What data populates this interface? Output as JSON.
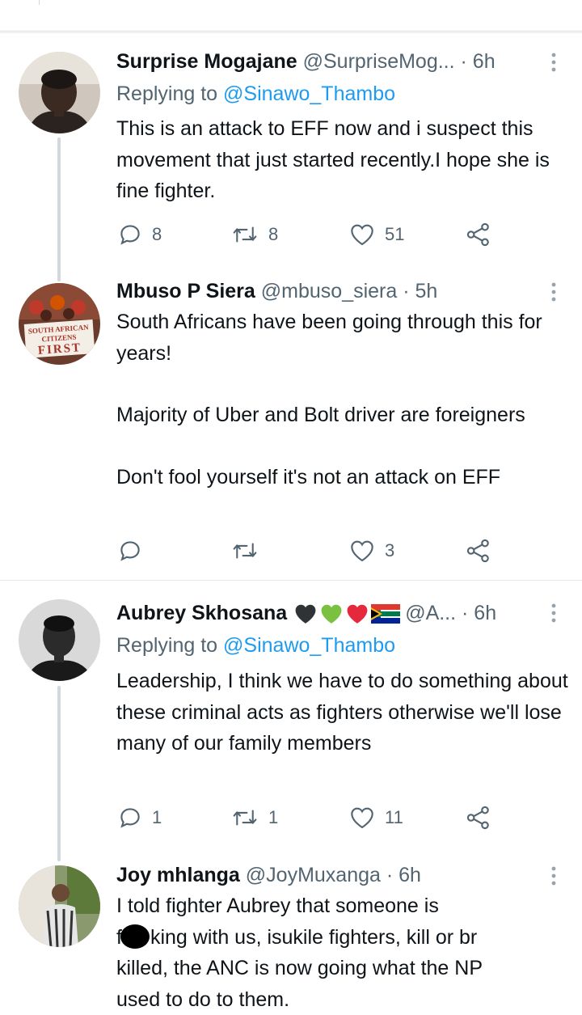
{
  "colors": {
    "link": "#1d9bf0",
    "muted": "#536471",
    "text": "#0f1419",
    "thread": "#cfd9de"
  },
  "tweets": [
    {
      "name": "Surprise Mogajane",
      "handle": "@SurpriseMog...",
      "time": "· 6h",
      "replying_prefix": "Replying to",
      "replying_to": "@Sinawo_Thambo",
      "paragraphs": [
        "This is an attack to EFF now and i suspect this movement that just started recently.I hope she is fine fighter."
      ],
      "replies": "8",
      "retweets": "8",
      "likes": "51"
    },
    {
      "name": "Mbuso P Siera",
      "handle": "@mbuso_siera",
      "time": "· 5h",
      "avatar_text": [
        "SOUTH AFRICAN",
        "CITIZENS",
        "FIRST"
      ],
      "paragraphs": [
        "South Africans have been going through this for years!",
        "Majority of Uber and Bolt driver are foreigners",
        "Don't fool yourself it's not an attack on EFF"
      ],
      "replies": "",
      "retweets": "",
      "likes": "3"
    },
    {
      "name": "Aubrey Skhosana",
      "handle": "@A...",
      "time": "· 6h",
      "name_emoji": [
        "black-heart",
        "green-heart",
        "red-heart",
        "south-africa-flag"
      ],
      "replying_prefix": "Replying to",
      "replying_to": "@Sinawo_Thambo",
      "paragraphs": [
        "Leadership, I think we have to do something about these criminal acts as fighters otherwise we'll lose many of our family members"
      ],
      "replies": "1",
      "retweets": "1",
      "likes": "11"
    },
    {
      "name": "Joy mhlanga",
      "handle": "@JoyMuxanga",
      "time": "· 6h",
      "lines": [
        "I told fighter Aubrey  that someone is",
        "f",
        "king with us, isukile fighters, kill or br",
        "killed, the ANC  is now going what the NP",
        "used to do to them."
      ]
    }
  ]
}
